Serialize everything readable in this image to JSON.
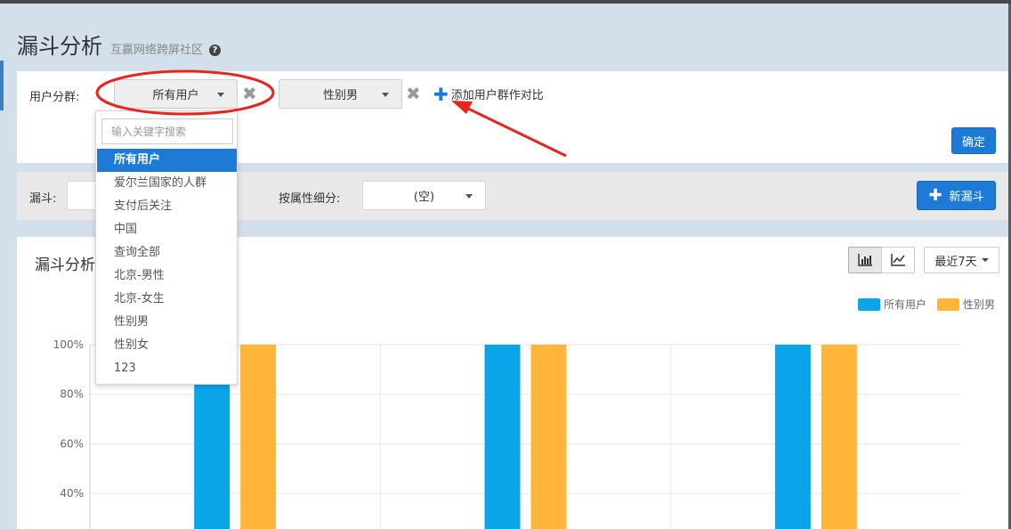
{
  "header": {
    "title": "漏斗分析",
    "subtitle": "互赢网络跨屏社区",
    "help_icon": "question-circle-icon"
  },
  "groups": {
    "label": "用户分群:",
    "selects": [
      {
        "value": "所有用户"
      },
      {
        "value": "性别男"
      }
    ],
    "add_label": "添加用户群作对比",
    "confirm_label": "确定"
  },
  "dropdown": {
    "search_placeholder": "输入关键字搜索",
    "items": [
      "所有用户",
      "爱尔兰国家的人群",
      "支付后关注",
      "中国",
      "查询全部",
      "北京-男性",
      "北京-女生",
      "性别男",
      "性别女",
      "123"
    ],
    "selected_index": 0
  },
  "funnel": {
    "label": "漏斗:",
    "value": "",
    "breakdown_label": "按属性细分:",
    "breakdown_value": "(空)",
    "new_label": "新漏斗"
  },
  "chart_panel": {
    "title": "漏斗分析",
    "range_label": "最近7天",
    "bar_icon": "bar-chart-icon",
    "line_icon": "line-chart-icon"
  },
  "colors": {
    "primary": "#1d7ad6",
    "series_all": "#0aa4e8",
    "series_male": "#ffb53a"
  },
  "chart_data": {
    "type": "bar",
    "categories": [
      "",
      "",
      ""
    ],
    "series": [
      {
        "name": "所有用户",
        "values": [
          100,
          100,
          100
        ]
      },
      {
        "name": "性别男",
        "values": [
          100,
          100,
          100
        ]
      }
    ],
    "ylim": [
      0,
      100
    ],
    "yticks": [
      "40%",
      "60%",
      "80%",
      "100%"
    ],
    "ytick_values": [
      40,
      60,
      80,
      100
    ],
    "grid": true,
    "legend": "top-right"
  }
}
